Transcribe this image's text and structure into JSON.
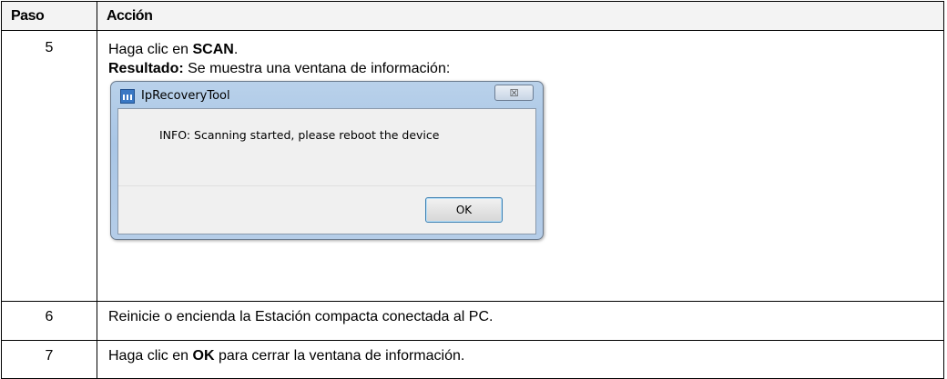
{
  "table": {
    "headers": {
      "step": "Paso",
      "action": "Acción"
    },
    "rows": [
      {
        "step": "5",
        "line1_prefix": "Haga clic en ",
        "line1_bold": "SCAN",
        "line1_suffix": ".",
        "line2_bold": "Resultado:",
        "line2_text": " Se muestra una ventana de información:"
      },
      {
        "step": "6",
        "text": "Reinicie o encienda la Estación compacta conectada al PC."
      },
      {
        "step": "7",
        "prefix": "Haga clic en ",
        "bold": "OK",
        "suffix": " para cerrar la ventana de información."
      }
    ]
  },
  "dialog": {
    "title": "IpRecoveryTool",
    "close_glyph": "☒",
    "message": "INFO: Scanning started, please reboot the device",
    "ok_label": "OK",
    "icon": "app-icon"
  },
  "colors": {
    "header_bg": "#f3f3f3",
    "dialog_frame": "#b9d1ea",
    "ok_border": "#3c7fb1"
  }
}
